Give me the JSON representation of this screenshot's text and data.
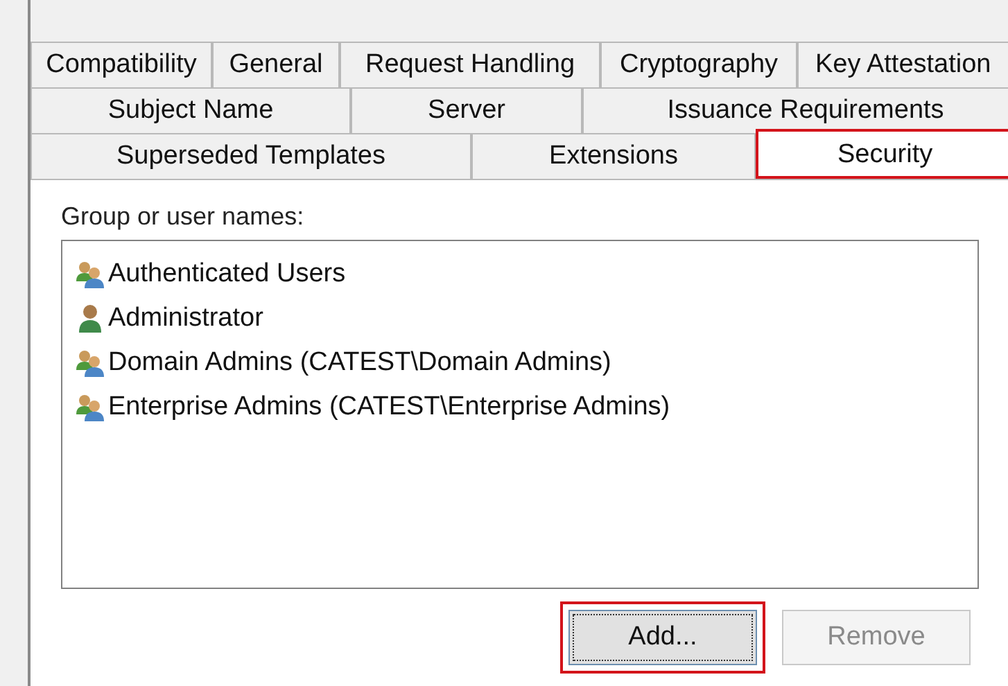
{
  "tab_rows": [
    {
      "tabs": [
        {
          "label": "Compatibility",
          "selected": false,
          "highlighted": false
        },
        {
          "label": "General",
          "selected": false,
          "highlighted": false
        },
        {
          "label": "Request Handling",
          "selected": false,
          "highlighted": false
        },
        {
          "label": "Cryptography",
          "selected": false,
          "highlighted": false
        },
        {
          "label": "Key Attestation",
          "selected": false,
          "highlighted": false
        }
      ]
    },
    {
      "tabs": [
        {
          "label": "Subject Name",
          "selected": false,
          "highlighted": false
        },
        {
          "label": "Server",
          "selected": false,
          "highlighted": false
        },
        {
          "label": "Issuance Requirements",
          "selected": false,
          "highlighted": false
        }
      ]
    },
    {
      "tabs": [
        {
          "label": "Superseded Templates",
          "selected": false,
          "highlighted": false
        },
        {
          "label": "Extensions",
          "selected": false,
          "highlighted": false
        },
        {
          "label": "Security",
          "selected": true,
          "highlighted": true
        }
      ]
    }
  ],
  "principals": {
    "label": "Group or user names:",
    "items": [
      {
        "name": "Authenticated Users",
        "kind": "group"
      },
      {
        "name": "Administrator",
        "kind": "user"
      },
      {
        "name": "Domain Admins (CATEST\\Domain Admins)",
        "kind": "group"
      },
      {
        "name": "Enterprise Admins (CATEST\\Enterprise Admins)",
        "kind": "group"
      }
    ]
  },
  "buttons": [
    {
      "label": "Add...",
      "disabled": false,
      "highlighted": true,
      "focused": true
    },
    {
      "label": "Remove",
      "disabled": true,
      "highlighted": false,
      "focused": false
    }
  ]
}
